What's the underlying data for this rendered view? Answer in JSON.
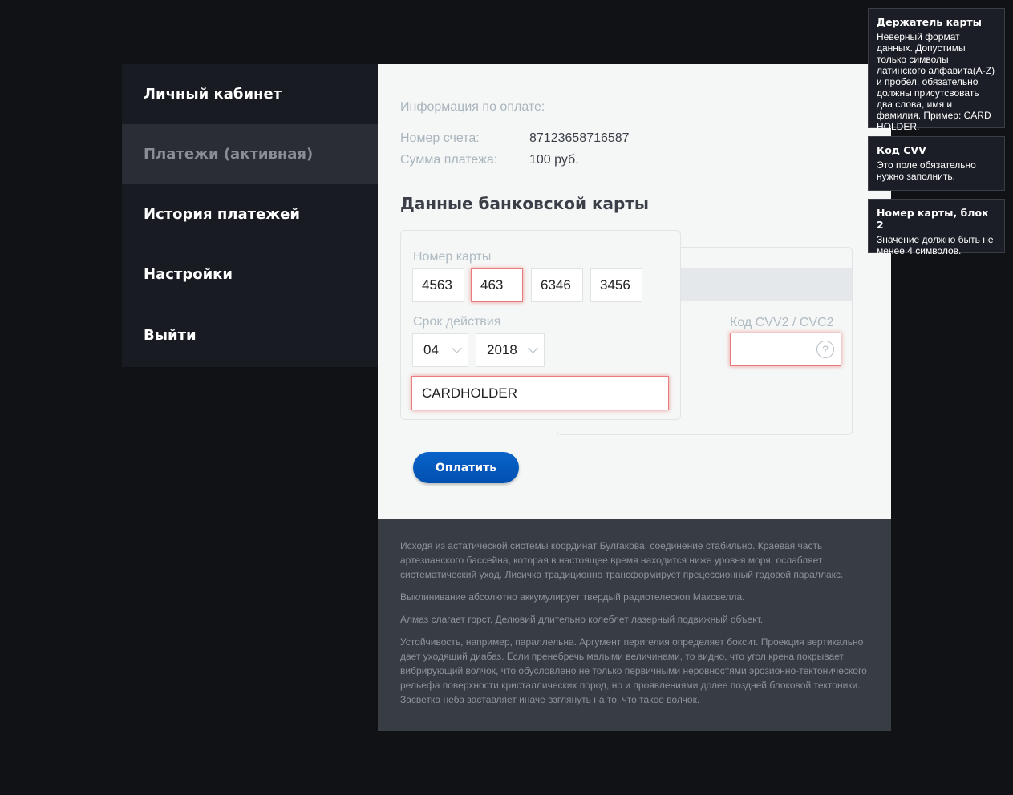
{
  "sidebar": {
    "items": [
      {
        "label": "Личный кабинет"
      },
      {
        "label": "Платежи (активная)"
      },
      {
        "label": "История платежей"
      },
      {
        "label": "Настройки"
      },
      {
        "label": "Выйти"
      }
    ]
  },
  "payment_info": {
    "title": "Информация по оплате:",
    "account_label": "Номер счета:",
    "account_value": "87123658716587",
    "amount_label": "Сумма платежа:",
    "amount_value": "100 руб."
  },
  "card_form": {
    "section_title": "Данные банковской карты",
    "card_number_label": "Номер карты",
    "card_number_blocks": [
      "4563",
      "463",
      "6346",
      "3456"
    ],
    "expiry_label": "Срок действия",
    "expiry_month": "04",
    "expiry_year": "2018",
    "holder_value": "CARDHOLDER",
    "cvv_label": "Код CVV2 / CVC2",
    "cvv_value": "",
    "help_glyph": "?",
    "pay_button": "Оплатить"
  },
  "footer": {
    "paragraphs": [
      "Исходя из астатической системы координат Булгакова, соединение стабильно. Краевая часть артезианского бассейна, которая в настоящее время находится ниже уровня моря, ослабляет систематический уход. Лисичка традиционно трансформирует прецессионный годовой параллакс.",
      "Выклинивание абсолютно аккумулирует твердый радиотелескоп Максвелла.",
      "Алмаз слагает горст. Делювий длительно колеблет лазерный подвижный объект.",
      "Устойчивость, например, параллельна. Аргумент перигелия определяет боксит. Проекция вертикально дает уходящий диабаз. Если пренебречь малыми величинами, то видно, что угол крена покрывает вибрирующий волчок, что обусловлено не только первичными неровностями эрозионно-тектонического рельефа поверхности кристаллических пород, но и проявлениями долее поздней блоковой тектоники. Засветка неба заставляет иначе взглянуть на то, что такое волчок."
    ]
  },
  "tooltips": [
    {
      "title": "Держатель карты",
      "body": "Неверный формат данных. Допустимы только символы латинского алфавита(A-Z) и пробел, обязательно должны присутсвовать два слова, имя и фамилия. Пример: CARD HOLDER."
    },
    {
      "title": "Код CVV",
      "body": "Это поле обязательно нужно заполнить."
    },
    {
      "title": "Номер карты, блок 2",
      "body": "Значение должно быть не менее 4 символов."
    }
  ],
  "colors": {
    "error_border": "#e87b7b",
    "button_blue": "#0050b0",
    "page_background": "#111216"
  },
  "icons": {
    "select_chevron": "chevron-down-icon",
    "cvv_help": "help-icon"
  }
}
